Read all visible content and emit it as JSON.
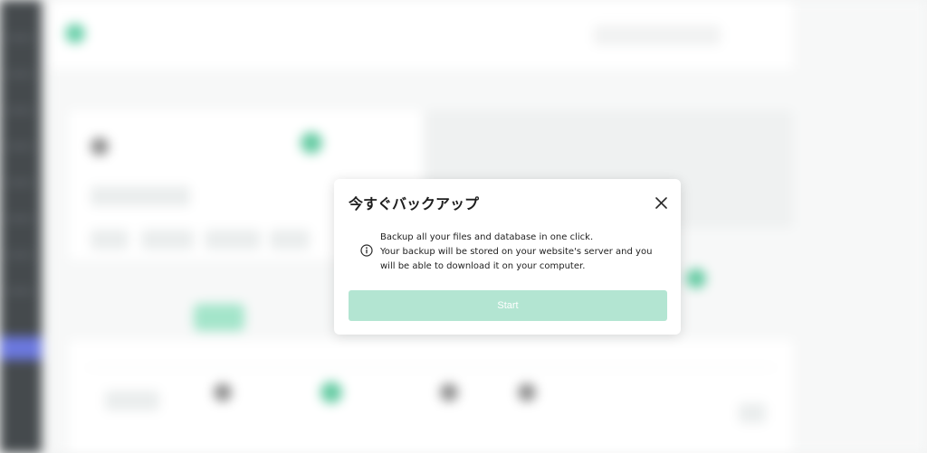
{
  "modal": {
    "title": "今すぐバックアップ",
    "line1": "Backup all your files and database in one click.",
    "line2": "Your backup will be stored on your website's server and you will be able to download it on your computer.",
    "start_label": "Start",
    "close_icon": "close-icon",
    "info_icon": "info-icon"
  },
  "colors": {
    "accent": "#49c596",
    "start_button_bg": "#b3e5d2",
    "sidebar_active": "#4b5bd7"
  }
}
